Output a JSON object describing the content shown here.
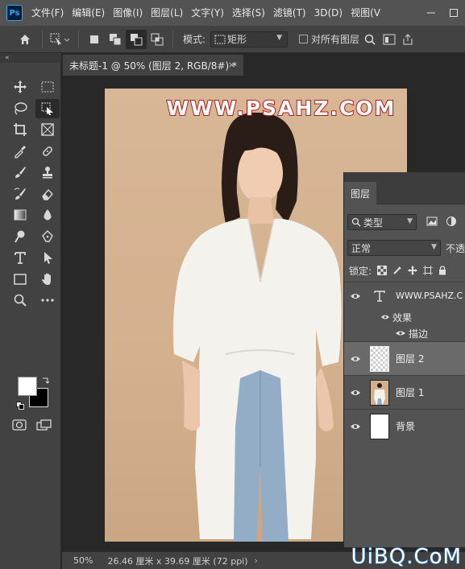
{
  "app": {
    "logo": "Ps",
    "menu": [
      "文件(F)",
      "编辑(E)",
      "图像(I)",
      "图层(L)",
      "文字(Y)",
      "选择(S)",
      "滤镜(T)",
      "3D(D)",
      "视图(V"
    ],
    "window_controls": [
      "minimize-icon",
      "restore-icon"
    ]
  },
  "options": {
    "mode_label": "模式:",
    "mode_value": "矩形",
    "align_label": "对所有图层"
  },
  "document": {
    "tab_title": "未标题-1 @ 50% (图层 2, RGB/8#) *",
    "close": "×",
    "watermark": "WWW.PSAHZ.COM"
  },
  "toolbar": {
    "collapse": "«",
    "foreground_color": "#ffffff",
    "background_color": "#000000"
  },
  "status": {
    "zoom": "50%",
    "doc_info": "26.46 厘米 x 39.69 厘米 (72 ppi)",
    "arrow": "›"
  },
  "corner_watermark": "UiBQ.CoM",
  "layers_panel": {
    "tab": "图层",
    "kind": "类型",
    "blend_mode": "正常",
    "opacity_label": "不透",
    "lock_label": "锁定:",
    "layers": [
      {
        "name": "WWW.PSAHZ.C",
        "type": "text",
        "effects_label": "效果",
        "effect": "描边"
      },
      {
        "name": "图层 2",
        "type": "transparent",
        "selected": true
      },
      {
        "name": "图层 1",
        "type": "photo"
      },
      {
        "name": "背景",
        "type": "white"
      }
    ]
  }
}
